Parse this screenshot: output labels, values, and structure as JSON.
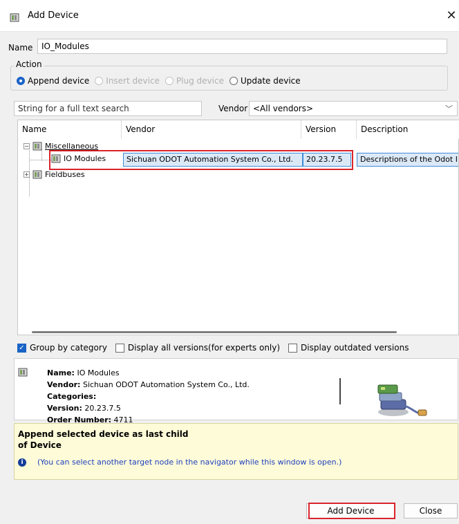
{
  "window": {
    "title": "Add Device",
    "close_glyph": "✕"
  },
  "name_field": {
    "label": "Name",
    "value": "IO_Modules"
  },
  "action": {
    "legend": "Action",
    "options": [
      {
        "label": "Append device",
        "checked": true,
        "enabled": true
      },
      {
        "label": "Insert device",
        "checked": false,
        "enabled": false
      },
      {
        "label": "Plug device",
        "checked": false,
        "enabled": false
      },
      {
        "label": "Update device",
        "checked": false,
        "enabled": true
      }
    ]
  },
  "search": {
    "placeholder": "String for a full text search",
    "vendor_label": "Vendor",
    "vendor_value": "<All vendors>"
  },
  "tree": {
    "columns": [
      "Name",
      "Vendor",
      "Version",
      "Description"
    ],
    "groups": [
      {
        "name": "Miscellaneous",
        "expanded": true,
        "expander": "−"
      },
      {
        "name": "Fieldbuses",
        "expanded": false,
        "expander": "+"
      }
    ],
    "selected_row": {
      "name": "IO Modules",
      "vendor": "Sichuan ODOT Automation System Co., Ltd.",
      "version": "20.23.7.5",
      "description": "Descriptions of the Odot I"
    }
  },
  "options": {
    "group_by_category": {
      "label": "Group by category",
      "checked": true
    },
    "display_all_versions": {
      "label": "Display all versions(for experts only)",
      "checked": false
    },
    "display_outdated": {
      "label": "Display outdated versions",
      "checked": false
    }
  },
  "info": {
    "name_label": "Name:",
    "name_value": "IO Modules",
    "vendor_label": "Vendor:",
    "vendor_value": "Sichuan ODOT Automation System Co., Ltd.",
    "categories_label": "Categories:",
    "version_label": "Version:",
    "version_value": "20.23.7.5",
    "order_label": "Order Number:",
    "order_value": "4711"
  },
  "hint": {
    "title": "Append selected device as last child of Device",
    "text": "(You can select another target node in the navigator while this window is open.)"
  },
  "buttons": {
    "add": "Add Device",
    "close": "Close"
  },
  "colors": {
    "accent": "#1a63c7",
    "highlight_box": "#d9232a",
    "hint_bg": "#fdfbd8",
    "selection_bg": "#dbe9f7"
  }
}
